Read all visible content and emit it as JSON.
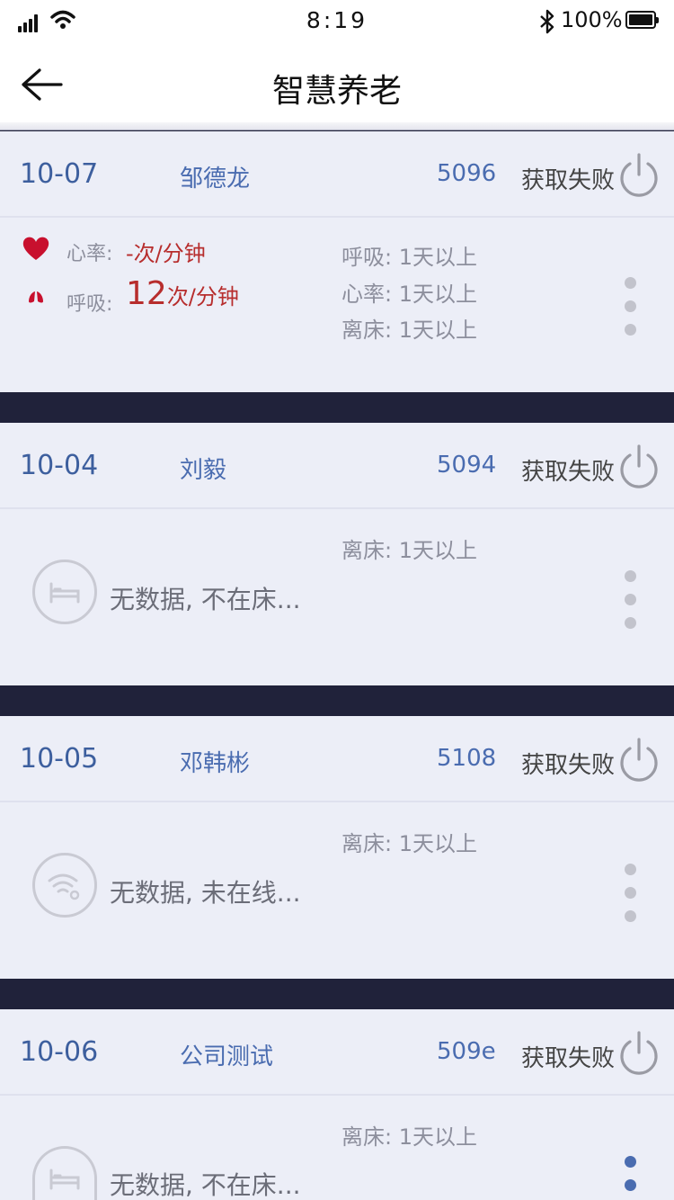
{
  "status_bar": {
    "time": "8:19",
    "battery": "100%"
  },
  "nav": {
    "title": "智慧养老"
  },
  "cards": [
    {
      "room": "10-07",
      "name": "邹德龙",
      "code": "5096",
      "status": "获取失败",
      "vitals": {
        "heart_label": "心率:",
        "heart_value": "-次/分钟",
        "breath_label": "呼吸:",
        "breath_value": "12",
        "breath_unit": "次/分钟"
      },
      "info": [
        "呼吸: 1天以上",
        "心率: 1天以上",
        "离床: 1天以上"
      ]
    },
    {
      "room": "10-04",
      "name": "刘毅",
      "code": "5094",
      "status": "获取失败",
      "info": [
        "离床: 1天以上"
      ],
      "nodata": "无数据, 不在床...",
      "icon": "bed-icon"
    },
    {
      "room": "10-05",
      "name": "邓韩彬",
      "code": "5108",
      "status": "获取失败",
      "info": [
        "离床: 1天以上"
      ],
      "nodata": "无数据, 未在线...",
      "icon": "wifi-off-icon"
    },
    {
      "room": "10-06",
      "name": "公司测试",
      "code": "509e",
      "status": "获取失败",
      "info": [
        "离床: 1天以上"
      ],
      "nodata": "无数据, 不在床...",
      "icon": "bed-icon"
    }
  ]
}
